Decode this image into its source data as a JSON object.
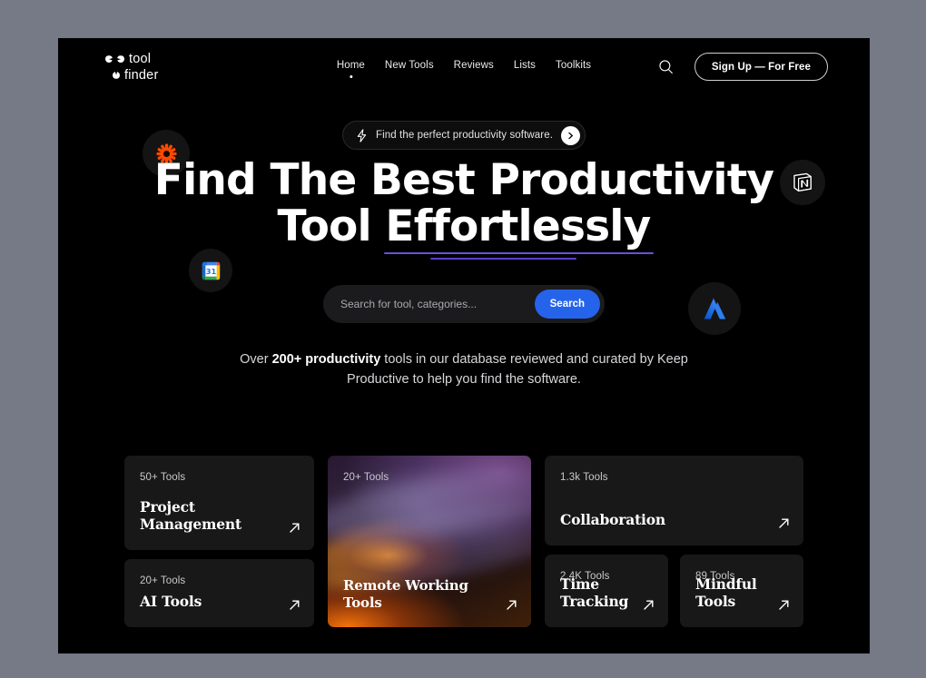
{
  "brand": {
    "line1": "tool",
    "line2": "finder"
  },
  "nav": {
    "items": [
      {
        "label": "Home",
        "active": true
      },
      {
        "label": "New Tools",
        "active": false
      },
      {
        "label": "Reviews",
        "active": false
      },
      {
        "label": "Lists",
        "active": false
      },
      {
        "label": "Toolkits",
        "active": false
      }
    ]
  },
  "header": {
    "search_icon": "search-icon",
    "signup_label": "Sign Up — For Free"
  },
  "hero": {
    "badge_text": "Find the perfect productivity software.",
    "badge_icon": "lightning-bolt-icon",
    "badge_arrow_icon": "chevron-right-icon",
    "title_line1": "Find The Best Productivity",
    "title_line2_pre": "Tool ",
    "title_line2_highlight": "Effortlessly",
    "subtitle_pre": "Over ",
    "subtitle_bold": "200+ productivity",
    "subtitle_post": " tools in our database reviewed and curated by Keep Productive to help you find the software."
  },
  "search": {
    "placeholder": "Search for tool, categories...",
    "value": "",
    "button_label": "Search"
  },
  "floating_logos": [
    {
      "name": "zapier-logo",
      "alt": "Zapier"
    },
    {
      "name": "notion-logo",
      "alt": "Notion"
    },
    {
      "name": "google-calendar-logo",
      "alt": "Google Calendar"
    },
    {
      "name": "atlassian-logo",
      "alt": "Atlassian"
    }
  ],
  "cards": [
    {
      "count": "50+ Tools",
      "title_line1": "Project",
      "title_line2": "Management"
    },
    {
      "count": "20+ Tools",
      "title_line1": "AI Tools",
      "title_line2": ""
    },
    {
      "count": "20+ Tools",
      "title_line1": "Remote  Working",
      "title_line2": "Tools"
    },
    {
      "count": "1.3k  Tools",
      "title_line1": "Collaboration",
      "title_line2": ""
    },
    {
      "count": "2.4K Tools",
      "title_line1": "Time",
      "title_line2": "Tracking"
    },
    {
      "count": "89 Tools",
      "title_line1": "Mindful",
      "title_line2": "Tools"
    }
  ],
  "colors": {
    "page_background": "#767986",
    "frame_background": "#000000",
    "card_background": "#181818",
    "accent_blue": "#2563eb",
    "underline_purple": "#6a4fd8",
    "zapier_orange": "#ff4a00"
  }
}
